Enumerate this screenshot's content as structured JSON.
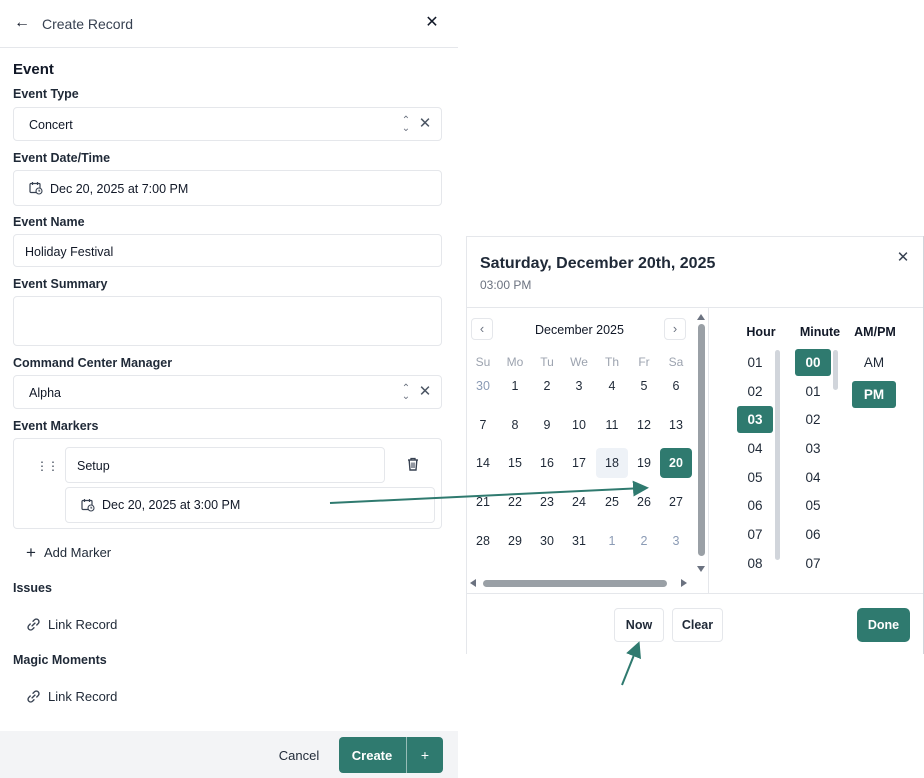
{
  "form": {
    "title": "Create Record",
    "section": "Event",
    "event_type": {
      "label": "Event Type",
      "value": "Concert"
    },
    "event_datetime": {
      "label": "Event Date/Time",
      "value": "Dec 20, 2025 at 7:00 PM"
    },
    "event_name": {
      "label": "Event Name",
      "value": "Holiday Festival"
    },
    "event_summary": {
      "label": "Event Summary",
      "value": ""
    },
    "manager": {
      "label": "Command Center Manager",
      "value": "Alpha"
    },
    "markers": {
      "label": "Event Markers",
      "items": [
        {
          "name": "Setup",
          "datetime": "Dec 20, 2025 at 3:00 PM"
        }
      ],
      "add_label": "Add Marker"
    },
    "issues": {
      "label": "Issues",
      "link_label": "Link Record"
    },
    "magic_moments": {
      "label": "Magic Moments",
      "link_label": "Link Record"
    },
    "footer": {
      "cancel": "Cancel",
      "create": "Create",
      "create_more": "+"
    }
  },
  "picker": {
    "title": "Saturday, December 20th, 2025",
    "subtitle": "03:00 PM",
    "month": "December 2025",
    "weekdays": [
      "Su",
      "Mo",
      "Tu",
      "We",
      "Th",
      "Fr",
      "Sa"
    ],
    "weeks": [
      [
        "30",
        "1",
        "2",
        "3",
        "4",
        "5",
        "6"
      ],
      [
        "7",
        "8",
        "9",
        "10",
        "11",
        "12",
        "13"
      ],
      [
        "14",
        "15",
        "16",
        "17",
        "18",
        "19",
        "20"
      ],
      [
        "21",
        "22",
        "23",
        "24",
        "25",
        "26",
        "27"
      ],
      [
        "28",
        "29",
        "30",
        "31",
        "1",
        "2",
        "3"
      ]
    ],
    "selected_day": "20",
    "hovered_day": "18",
    "hour_label": "Hour",
    "minute_label": "Minute",
    "ampm_label": "AM/PM",
    "hours": [
      "01",
      "02",
      "03",
      "04",
      "05",
      "06",
      "07",
      "08"
    ],
    "selected_hour": "03",
    "minutes": [
      "00",
      "01",
      "02",
      "03",
      "04",
      "05",
      "06",
      "07"
    ],
    "selected_minute": "00",
    "ampm": [
      "AM",
      "PM"
    ],
    "selected_ampm": "PM",
    "now_label": "Now",
    "clear_label": "Clear",
    "done_label": "Done"
  },
  "colors": {
    "accent": "#2f7a6f",
    "annotation_arrow": "#2f7a6f"
  },
  "icons": {
    "back": "arrow-left-icon",
    "close": "close-icon",
    "calendar": "calendar-clock-icon",
    "sort": "chevron-up-down-icon",
    "clear": "close-icon",
    "drag": "drag-handle-icon",
    "trash": "trash-icon",
    "link": "link-icon",
    "prev_month": "chevron-left-icon",
    "next_month": "chevron-right-icon"
  }
}
